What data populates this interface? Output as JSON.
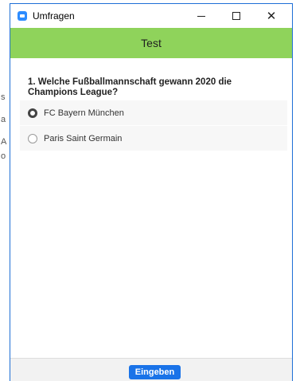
{
  "window": {
    "title": "Umfragen",
    "controls": {
      "minimize_icon": "minimize-icon",
      "maximize_icon": "maximize-icon",
      "close_glyph": "✕"
    }
  },
  "background_fragments": [
    "s",
    "a",
    "A",
    "o"
  ],
  "poll": {
    "title": "Test",
    "header_color": "#8fd35b",
    "question": "1. Welche Fußballmannschaft gewann 2020 die Champions League?",
    "options": [
      {
        "label": "FC Bayern München",
        "selected": true
      },
      {
        "label": "Paris Saint Germain",
        "selected": false
      }
    ]
  },
  "footer": {
    "submit_label": "Eingeben",
    "accent_color": "#1a73e8"
  }
}
